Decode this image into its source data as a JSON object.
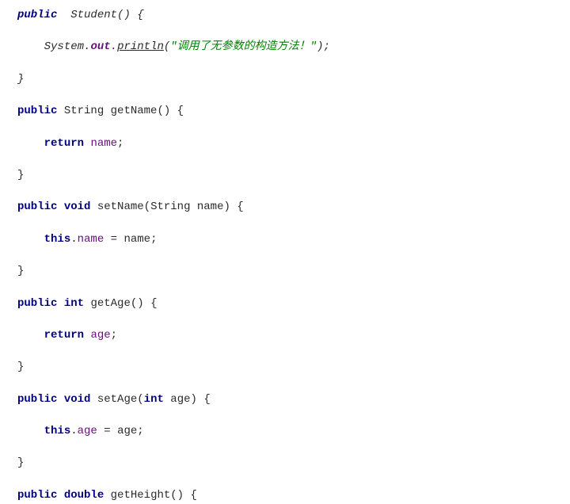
{
  "lines": {
    "l1": {
      "kw1": "public  ",
      "name": "Student",
      "rest": "() {"
    },
    "l2": {
      "sys": "System",
      "dot1": ".",
      "out": "out",
      "dot2": ".",
      "method": "println",
      "paren1": "(",
      "str": "\"调用了无参数的构造方法！\"",
      "paren2": ");"
    },
    "l3": {
      "brace": "}"
    },
    "l4": {
      "kw1": "public",
      "type": " String ",
      "name": "getName",
      "rest": "() {"
    },
    "l5": {
      "kw1": "return",
      "sp": " ",
      "field": "name",
      "semi": ";"
    },
    "l6": {
      "brace": "}"
    },
    "l7": {
      "kw1": "public",
      "sp1": " ",
      "kw2": "void",
      "sp2": " ",
      "name": "setName",
      "paren1": "(",
      "ptype": "String ",
      "pname": "name",
      "paren2": ") {"
    },
    "l8": {
      "kw1": "this",
      "dot": ".",
      "field": "name",
      "eq": " = ",
      "param": "name",
      "semi": ";"
    },
    "l9": {
      "brace": "}"
    },
    "l10": {
      "kw1": "public",
      "sp1": " ",
      "kw2": "int",
      "sp2": " ",
      "name": "getAge",
      "rest": "() {"
    },
    "l11": {
      "kw1": "return",
      "sp": " ",
      "field": "age",
      "semi": ";"
    },
    "l12": {
      "brace": "}"
    },
    "l13": {
      "kw1": "public",
      "sp1": " ",
      "kw2": "void",
      "sp2": " ",
      "name": "setAge",
      "paren1": "(",
      "ptype": "int",
      "sp3": " ",
      "pname": "age",
      "paren2": ") {"
    },
    "l14": {
      "kw1": "this",
      "dot": ".",
      "field": "age",
      "eq": " = ",
      "param": "age",
      "semi": ";"
    },
    "l15": {
      "brace": "}"
    },
    "l16": {
      "kw1": "public",
      "sp1": " ",
      "kw2": "double",
      "sp2": " ",
      "name": "getHeight",
      "rest": "() {"
    }
  }
}
